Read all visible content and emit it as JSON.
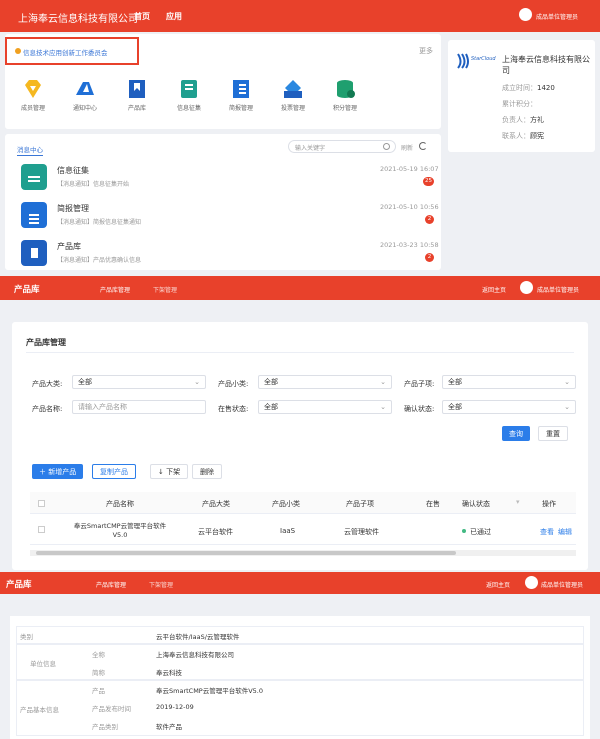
{
  "s1": {
    "brand": "上海奉云信息科技有限公司",
    "nav": [
      "首页",
      "应用"
    ],
    "user": "成品单位管理员",
    "tab_label": "信息技术应用创新工作委员会",
    "more": "更多",
    "apps": [
      "成员管理",
      "通知中心",
      "产品库",
      "信息征集",
      "简报管理",
      "投票管理",
      "积分管理"
    ],
    "profile": {
      "logo_text": "StarCloud",
      "company": "上海奉云信息科技有限公司",
      "established_label": "成立时间：",
      "established": "1420",
      "points_label": "累计积分：",
      "points": "",
      "owner_label": "负责人：",
      "owner": "方礼",
      "contact_label": "联系人：",
      "contact": "顾宪"
    },
    "msg_tab": "消息中心",
    "search_placeholder": "输入关键字",
    "refresh": "刷新",
    "messages": [
      {
        "title": "信息征集",
        "sub": "【消息通知】信息征集开始",
        "time": "2021-05-19 16:07",
        "badge": "25",
        "color": "#1f9f8f"
      },
      {
        "title": "简报管理",
        "sub": "【消息通知】简报信息征集通知",
        "time": "2021-05-10 10:56",
        "badge": "2",
        "color": "#1f6fd6"
      },
      {
        "title": "产品库",
        "sub": "【消息通知】产品优惠确认信息",
        "time": "2021-03-23 10:58",
        "badge": "2",
        "color": "#1f5fbf"
      }
    ]
  },
  "s2": {
    "brand": "产品库",
    "nav": [
      "产品库管理",
      "下架管理"
    ],
    "back": "返回主页",
    "user": "成品单位管理员",
    "section_title": "产品库管理",
    "filters": [
      {
        "label": "产品大类:",
        "value": "全部"
      },
      {
        "label": "产品小类:",
        "value": "全部"
      },
      {
        "label": "产品子项:",
        "value": "全部"
      },
      {
        "label": "产品名称:",
        "value": "",
        "placeholder": "请输入产品名称"
      },
      {
        "label": "在售状态:",
        "value": "全部"
      },
      {
        "label": "确认状态:",
        "value": "全部"
      }
    ],
    "query": "查询",
    "reset": "重置",
    "actions": [
      "＋ 新增产品",
      "复制产品",
      "↓ 下架",
      "删除"
    ],
    "columns": [
      "产品名称",
      "产品大类",
      "产品小类",
      "产品子项",
      "在售",
      "确认状态",
      "操作"
    ],
    "row": {
      "name": "奉云SmartCMP云管理平台软件V5.0",
      "major": "云平台软件",
      "minor": "IaaS",
      "sub": "云管理软件",
      "status": "已通过",
      "ops": [
        "查看",
        "编辑"
      ]
    }
  },
  "s3": {
    "brand": "产品库",
    "nav": [
      "产品库管理",
      "下架管理"
    ],
    "back": "返回主页",
    "user": "成品单位管理员",
    "rows": [
      {
        "group": "类别",
        "key": "",
        "value": "云平台软件/IaaS/云管理软件"
      },
      {
        "group": "单位信息",
        "key": "全称",
        "value": "上海奉云信息科技有限公司"
      },
      {
        "group": "",
        "key": "简称",
        "value": "奉云科技"
      },
      {
        "group": "产品基本信息",
        "key": "产品",
        "value": "奉云SmartCMP云管理平台软件V5.0"
      },
      {
        "group": "",
        "key": "产品发布时间",
        "value": "2019-12-09"
      },
      {
        "group": "",
        "key": "产品类别",
        "value": "软件产品"
      }
    ]
  }
}
